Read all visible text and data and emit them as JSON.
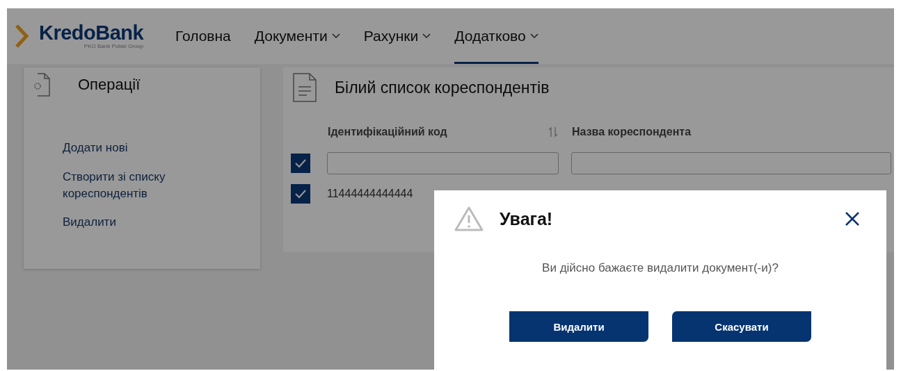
{
  "logo": {
    "name": "KredoBank",
    "tagline": "PKO Bank Polski Group"
  },
  "nav": [
    {
      "label": "Головна",
      "dropdown": false,
      "selected": false
    },
    {
      "label": "Документи",
      "dropdown": true,
      "selected": false
    },
    {
      "label": "Рахунки",
      "dropdown": true,
      "selected": false
    },
    {
      "label": "Додатково",
      "dropdown": true,
      "selected": true
    }
  ],
  "operations": {
    "title": "Операції",
    "items": [
      "Додати нові",
      "Створити зі списку кореспондентів",
      "Видалити"
    ]
  },
  "list": {
    "title": "Білий список кореспондентів",
    "columns": [
      {
        "label": "Ідентифікаційний код",
        "sortable": true
      },
      {
        "label": "Назва кореспондента",
        "sortable": false
      }
    ],
    "filter_row": {
      "checked": true
    },
    "rows": [
      {
        "checked": true,
        "cells": [
          "11444444444444"
        ]
      }
    ]
  },
  "dialog": {
    "title": "Увага!",
    "message": "Ви дійсно бажаєте видалити документ(-и)?",
    "buttons": [
      {
        "label": "Видалити"
      },
      {
        "label": "Скасувати"
      }
    ]
  }
}
